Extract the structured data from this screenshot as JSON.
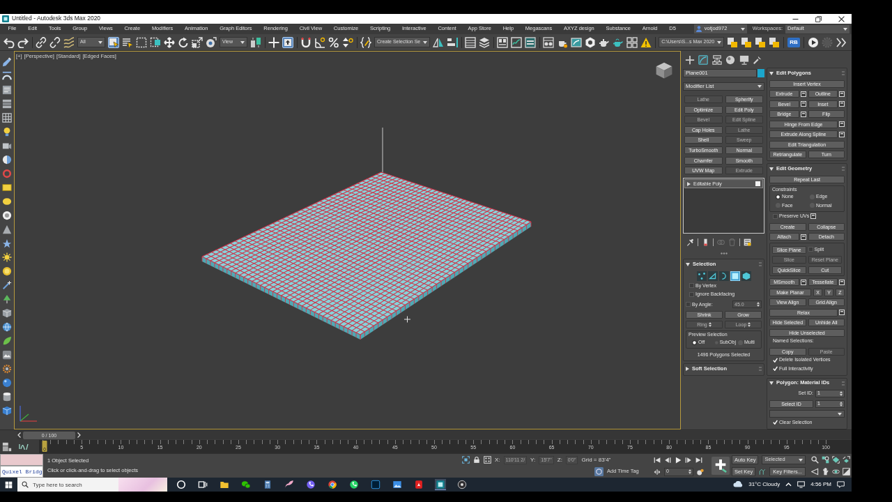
{
  "window": {
    "title": "Untitled - Autodesk 3ds Max 2020"
  },
  "menu_bar": {
    "items": [
      "File",
      "Edit",
      "Tools",
      "Group",
      "Views",
      "Create",
      "Modifiers",
      "Animation",
      "Graph Editors",
      "Rendering",
      "Civil View",
      "Customize",
      "Scripting",
      "Interactive",
      "Content",
      "App Store",
      "Help",
      "Megascans",
      "AXYZ design",
      "Substance",
      "Arnold",
      "D5"
    ],
    "user": "votjod972",
    "workspaces_label": "Workspaces:",
    "workspace": "Default"
  },
  "main_toolbar": {
    "items": [
      {
        "kind": "undo"
      },
      {
        "kind": "redo"
      },
      {
        "kind": "sep"
      },
      {
        "kind": "link"
      },
      {
        "kind": "unlink"
      },
      {
        "kind": "bind"
      },
      {
        "kind": "dropdown",
        "value": "All"
      },
      {
        "kind": "select",
        "active": true
      },
      {
        "kind": "select-by-name",
        "active": false
      },
      {
        "kind": "region",
        "active": false
      },
      {
        "kind": "crossing",
        "active": false
      },
      {
        "kind": "move",
        "active": false
      },
      {
        "kind": "rotate",
        "active": false
      },
      {
        "kind": "scale",
        "active": false
      },
      {
        "kind": "placement",
        "active": false
      },
      {
        "kind": "dropdown",
        "value": "View"
      },
      {
        "kind": "pivot"
      },
      {
        "kind": "sep"
      },
      {
        "kind": "manipulate",
        "active": false
      },
      {
        "kind": "shortcut",
        "active": true
      },
      {
        "kind": "sep"
      },
      {
        "kind": "snap",
        "active": false
      },
      {
        "kind": "angle-snap",
        "active": false
      },
      {
        "kind": "percent-snap",
        "active": false
      },
      {
        "kind": "spinner-snap",
        "active": false
      },
      {
        "kind": "sep"
      },
      {
        "kind": "named-sets"
      },
      {
        "kind": "dropdown",
        "value": "Create Selection Se"
      },
      {
        "kind": "mirror"
      },
      {
        "kind": "align"
      },
      {
        "kind": "sep"
      },
      {
        "kind": "scene-explorer"
      },
      {
        "kind": "layer-explorer"
      },
      {
        "kind": "sep"
      },
      {
        "kind": "ribbon"
      },
      {
        "kind": "curve-editor"
      },
      {
        "kind": "schematic"
      },
      {
        "kind": "sep"
      },
      {
        "kind": "material-editor"
      },
      {
        "kind": "render-setup"
      },
      {
        "kind": "frame-window"
      },
      {
        "kind": "render"
      },
      {
        "kind": "render-iterative"
      },
      {
        "kind": "render-cloud"
      },
      {
        "kind": "grid-tiles"
      },
      {
        "kind": "warning"
      },
      {
        "kind": "sep"
      },
      {
        "kind": "dropdown",
        "value": "C:\\Users\\S...s Max 2020"
      },
      {
        "kind": "project"
      },
      {
        "kind": "project"
      },
      {
        "kind": "project"
      },
      {
        "kind": "project"
      },
      {
        "kind": "sep"
      },
      {
        "kind": "rb",
        "label": "RB"
      },
      {
        "kind": "sep"
      },
      {
        "kind": "play-circle"
      },
      {
        "kind": "gear",
        "disabled": true
      },
      {
        "kind": "more"
      }
    ]
  },
  "viewport": {
    "labels": [
      "[+]",
      "[Perspective]",
      "[Standard]",
      "[Edged Faces]"
    ],
    "active": true
  },
  "command_panel": {
    "tabs": [
      {
        "kind": "create",
        "selected": false
      },
      {
        "kind": "modify",
        "selected": true
      },
      {
        "kind": "hierarchy",
        "selected": false
      },
      {
        "kind": "motion",
        "selected": false
      },
      {
        "kind": "display",
        "selected": false
      },
      {
        "kind": "utilities",
        "selected": false
      }
    ],
    "object_name": "Plane001",
    "modifier_list": "Modifier List",
    "modifiers": [
      {
        "label": "Lathe",
        "disabled": true
      },
      {
        "label": "Spherify",
        "disabled": false
      },
      {
        "label": "Optimize",
        "disabled": false
      },
      {
        "label": "Edit Poly",
        "disabled": false
      },
      {
        "label": "Bevel",
        "disabled": true
      },
      {
        "label": "Edit Spline",
        "disabled": true
      },
      {
        "label": "Cap Holes",
        "disabled": false
      },
      {
        "label": "Lathe",
        "disabled": true
      },
      {
        "label": "Shell",
        "disabled": false
      },
      {
        "label": "Sweep",
        "disabled": true
      },
      {
        "label": "TurboSmooth",
        "disabled": false
      },
      {
        "label": "Normal",
        "disabled": false
      },
      {
        "label": "Chamfer",
        "disabled": false
      },
      {
        "label": "Smooth",
        "disabled": false
      },
      {
        "label": "UVW Map",
        "disabled": false
      },
      {
        "label": "Extrude",
        "disabled": true
      }
    ],
    "stack": [
      {
        "label": "Editable Poly",
        "selected": true,
        "expanded": false,
        "on": true
      }
    ],
    "stack_tools": [
      {
        "kind": "pin",
        "disabled": false
      },
      {
        "kind": "sep"
      },
      {
        "kind": "end-result",
        "disabled": false
      },
      {
        "kind": "sep"
      },
      {
        "kind": "make-unique",
        "disabled": true
      },
      {
        "kind": "remove",
        "disabled": true
      },
      {
        "kind": "sep"
      },
      {
        "kind": "configure",
        "disabled": false
      }
    ],
    "rollout_columns": [
      [
        {
          "title": "Selection",
          "expanded": true,
          "body": [
            {
              "kind": "row",
              "items": [
                {
                  "kind": "levels",
                  "levels": [
                    {
                      "kind": "vertex",
                      "selected": false
                    },
                    {
                      "kind": "edge",
                      "selected": false
                    },
                    {
                      "kind": "border",
                      "selected": false
                    },
                    {
                      "kind": "polygon",
                      "selected": true
                    },
                    {
                      "kind": "element",
                      "selected": false
                    }
                  ]
                }
              ]
            },
            {
              "kind": "row",
              "items": [
                {
                  "kind": "check",
                  "label": "By Vertex",
                  "checked": false
                }
              ]
            },
            {
              "kind": "row",
              "items": [
                {
                  "kind": "check",
                  "label": "Ignore Backfacing",
                  "checked": false
                }
              ]
            },
            {
              "kind": "row",
              "items": [
                {
                  "kind": "check",
                  "label": "By Angle:",
                  "checked": false
                },
                {
                  "kind": "spinner",
                  "value": "45.0",
                  "disabled": true
                }
              ]
            },
            {
              "kind": "row",
              "items": [
                {
                  "kind": "button",
                  "label": "Shrink",
                  "disabled": false
                },
                {
                  "kind": "button",
                  "label": "Grow",
                  "disabled": false
                }
              ]
            },
            {
              "kind": "row",
              "items": [
                {
                  "kind": "spin-button",
                  "label": "Ring",
                  "disabled": true
                },
                {
                  "kind": "spin-button",
                  "label": "Loop",
                  "disabled": true
                }
              ]
            },
            {
              "kind": "group",
              "title": "Preview Selection",
              "rows": [
                {
                  "kind": "row",
                  "items": [
                    {
                      "kind": "radio",
                      "label": "Off",
                      "selected": true
                    },
                    {
                      "kind": "radio",
                      "label": "SubObj",
                      "selected": false
                    },
                    {
                      "kind": "radio",
                      "label": "Multi",
                      "selected": false
                    }
                  ]
                }
              ]
            },
            {
              "kind": "row",
              "items": [
                {
                  "kind": "status",
                  "text": "1496 Polygons Selected"
                }
              ]
            }
          ]
        },
        {
          "title": "Soft Selection",
          "expanded": false
        }
      ],
      [
        {
          "title": "Edit Polygons",
          "expanded": true,
          "body": [
            {
              "kind": "row",
              "items": [
                {
                  "kind": "button",
                  "label": "Insert Vertex",
                  "settings": false
                }
              ]
            },
            {
              "kind": "row",
              "items": [
                {
                  "kind": "button",
                  "label": "Extrude",
                  "settings": true
                },
                {
                  "kind": "button",
                  "label": "Outline",
                  "settings": true
                }
              ]
            },
            {
              "kind": "row",
              "items": [
                {
                  "kind": "button",
                  "label": "Bevel",
                  "settings": true
                },
                {
                  "kind": "button",
                  "label": "Inset",
                  "settings": true
                }
              ]
            },
            {
              "kind": "row",
              "items": [
                {
                  "kind": "button",
                  "label": "Bridge",
                  "settings": true
                },
                {
                  "kind": "button",
                  "label": "Flip",
                  "settings": false
                }
              ]
            },
            {
              "kind": "row",
              "items": [
                {
                  "kind": "button",
                  "label": "Hinge From Edge",
                  "settings": true
                }
              ]
            },
            {
              "kind": "row",
              "items": [
                {
                  "kind": "button",
                  "label": "Extrude Along Spline",
                  "settings": true
                }
              ]
            },
            {
              "kind": "row",
              "items": [
                {
                  "kind": "button",
                  "label": "Edit Triangulation",
                  "settings": false
                }
              ]
            },
            {
              "kind": "row",
              "items": [
                {
                  "kind": "button",
                  "label": "Retriangulate",
                  "settings": false
                },
                {
                  "kind": "button",
                  "label": "Turn",
                  "settings": false
                }
              ]
            }
          ]
        },
        {
          "title": "Edit Geometry",
          "expanded": true,
          "body": [
            {
              "kind": "row",
              "items": [
                {
                  "kind": "button",
                  "label": "Repeat Last"
                }
              ]
            },
            {
              "kind": "group",
              "title": "Constraints",
              "rows": [
                {
                  "kind": "row",
                  "items": [
                    {
                      "kind": "radio",
                      "label": "None",
                      "selected": true
                    },
                    {
                      "kind": "radio",
                      "label": "Edge",
                      "selected": false
                    }
                  ]
                },
                {
                  "kind": "row",
                  "items": [
                    {
                      "kind": "radio",
                      "label": "Face",
                      "selected": false
                    },
                    {
                      "kind": "radio",
                      "label": "Normal",
                      "selected": false
                    }
                  ]
                }
              ]
            },
            {
              "kind": "row",
              "items": [
                {
                  "kind": "check",
                  "label": "Preserve UVs",
                  "checked": false,
                  "settings": true
                }
              ]
            },
            {
              "kind": "row",
              "items": [
                {
                  "kind": "button",
                  "label": "Create"
                },
                {
                  "kind": "button",
                  "label": "Collapse"
                }
              ]
            },
            {
              "kind": "row",
              "items": [
                {
                  "kind": "button",
                  "label": "Attach",
                  "settings": true
                },
                {
                  "kind": "button",
                  "label": "Detach"
                }
              ]
            },
            {
              "kind": "group",
              "rows": [
                {
                  "kind": "row",
                  "items": [
                    {
                      "kind": "button",
                      "label": "Slice Plane",
                      "disabled": false
                    },
                    {
                      "kind": "check",
                      "label": "Split",
                      "checked": false
                    }
                  ]
                },
                {
                  "kind": "row",
                  "items": [
                    {
                      "kind": "button",
                      "label": "Slice",
                      "disabled": true
                    },
                    {
                      "kind": "button",
                      "label": "Reset Plane",
                      "disabled": true
                    }
                  ]
                },
                {
                  "kind": "row",
                  "items": [
                    {
                      "kind": "button",
                      "label": "QuickSlice",
                      "disabled": false
                    },
                    {
                      "kind": "button",
                      "label": "Cut",
                      "disabled": false
                    }
                  ]
                }
              ]
            },
            {
              "kind": "row",
              "items": [
                {
                  "kind": "button",
                  "label": "MSmooth",
                  "settings": true
                },
                {
                  "kind": "button",
                  "label": "Tessellate",
                  "settings": true
                }
              ]
            },
            {
              "kind": "row",
              "items": [
                {
                  "kind": "button",
                  "label": "Make Planar"
                },
                {
                  "kind": "axis-button",
                  "label": "X"
                },
                {
                  "kind": "axis-button",
                  "label": "Y"
                },
                {
                  "kind": "axis-button",
                  "label": "Z"
                }
              ]
            },
            {
              "kind": "row",
              "items": [
                {
                  "kind": "button",
                  "label": "View Align"
                },
                {
                  "kind": "button",
                  "label": "Grid Align"
                }
              ]
            },
            {
              "kind": "row",
              "items": [
                {
                  "kind": "button",
                  "label": "Relax",
                  "settings": true
                }
              ]
            },
            {
              "kind": "row",
              "items": [
                {
                  "kind": "button",
                  "label": "Hide Selected"
                },
                {
                  "kind": "button",
                  "label": "Unhide All"
                }
              ]
            },
            {
              "kind": "row",
              "items": [
                {
                  "kind": "button",
                  "label": "Hide Unselected"
                }
              ]
            },
            {
              "kind": "row",
              "items": [
                {
                  "kind": "label",
                  "text": "Named Selections:"
                }
              ]
            },
            {
              "kind": "row",
              "items": [
                {
                  "kind": "button",
                  "label": "Copy",
                  "disabled": false
                },
                {
                  "kind": "button",
                  "label": "Paste",
                  "disabled": true
                }
              ]
            },
            {
              "kind": "row",
              "items": [
                {
                  "kind": "check",
                  "label": "Delete Isolated Vertices",
                  "checked": true
                }
              ]
            },
            {
              "kind": "row",
              "items": [
                {
                  "kind": "check",
                  "label": "Full Interactivity",
                  "checked": true
                }
              ]
            }
          ]
        },
        {
          "title": "Polygon: Material IDs",
          "expanded": true,
          "body": [
            {
              "kind": "row",
              "items": [
                {
                  "kind": "label",
                  "text": "Set ID:"
                },
                {
                  "kind": "spinner",
                  "value": "1"
                }
              ]
            },
            {
              "kind": "row",
              "items": [
                {
                  "kind": "button",
                  "label": "Select ID"
                },
                {
                  "kind": "spinner",
                  "value": "1"
                }
              ]
            },
            {
              "kind": "row",
              "items": [
                {
                  "kind": "dropdown"
                }
              ]
            },
            {
              "kind": "row",
              "items": [
                {
                  "kind": "check",
                  "label": "Clear Selection",
                  "checked": true
                }
              ]
            }
          ]
        }
      ]
    ]
  },
  "time_slider": {
    "label": "0 / 100",
    "level": 0,
    "current_frame": "0",
    "tick_labels": [
      "5",
      "10",
      "15",
      "20",
      "25",
      "30",
      "35",
      "40",
      "45",
      "50",
      "55",
      "60",
      "65",
      "70",
      "75",
      "80",
      "85",
      "90",
      "95",
      "100"
    ]
  },
  "status_bar": {
    "quixel_label": "Quixel Bridg",
    "selection": "1 Object Selected",
    "prompt": "Click or click-and-drag to select objects",
    "coords": [
      {
        "axis": "X:",
        "value": "110'11 2/"
      },
      {
        "axis": "Y:",
        "value": "15'7\""
      },
      {
        "axis": "Z:",
        "value": "0'0\""
      }
    ],
    "grid": "Grid = 83'4\"",
    "time_tag": "Add Time Tag",
    "frame": "0",
    "auto_key": {
      "label": "Auto Key",
      "on": false
    },
    "set_key": "Set Key",
    "key_mode": "Selected",
    "key_filters": "Key Filters..."
  },
  "taskbar": {
    "search_placeholder": "Type here to search",
    "apps": [
      {
        "kind": "cortana",
        "active": false
      },
      {
        "kind": "task-view",
        "active": false
      },
      {
        "kind": "explorer",
        "active": false
      },
      {
        "kind": "wechat",
        "active": false
      },
      {
        "kind": "calculator",
        "active": false
      },
      {
        "kind": "paint",
        "active": false
      },
      {
        "kind": "viber",
        "active": false
      },
      {
        "kind": "chrome",
        "active": false
      },
      {
        "kind": "whatsapp",
        "active": false
      },
      {
        "kind": "photoshop",
        "active": false
      },
      {
        "kind": "photos",
        "active": false
      },
      {
        "kind": "acrobat",
        "active": false
      },
      {
        "kind": "max",
        "active": true
      },
      {
        "kind": "obs",
        "active": false
      }
    ],
    "weather": "31°C Cloudy",
    "time": "4:56 PM"
  }
}
